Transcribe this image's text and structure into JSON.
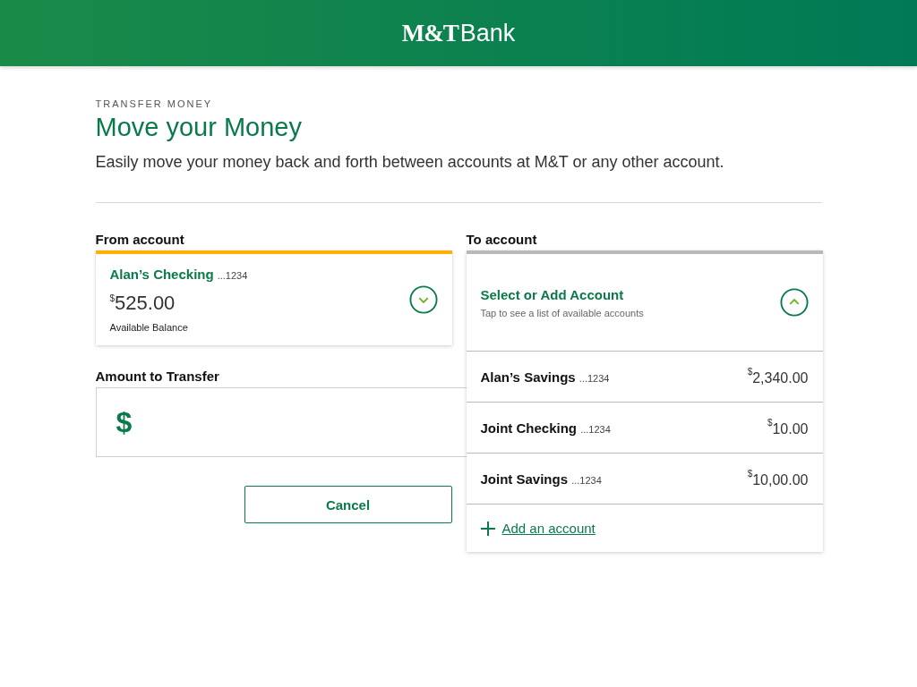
{
  "header": {
    "logo_bold": "M&T",
    "logo_light": "Bank"
  },
  "page": {
    "eyebrow": "TRANSFER MONEY",
    "title": "Move your Money",
    "description": "Easily move your money back and forth between accounts at M&T or any other account."
  },
  "from_account": {
    "label": "From account",
    "expanded": false,
    "name": "Alan’s Checking",
    "number": "...1234",
    "currency": "$",
    "balance": "525.00",
    "balance_label": "Available Balance"
  },
  "to_account": {
    "label": "To account",
    "expanded": true,
    "title": "Select or Add Account",
    "hint": "Tap to see a list of available accounts",
    "options": [
      {
        "name": "Alan’s Savings",
        "number": "...1234",
        "currency": "$",
        "amount": "2,340.00"
      },
      {
        "name": "Joint Checking",
        "number": "...1234",
        "currency": "$",
        "amount": "10.00"
      },
      {
        "name": "Joint Savings",
        "number": "...1234",
        "currency": "$",
        "amount": "10,00.00"
      }
    ],
    "add_link": "Add an account"
  },
  "amount": {
    "label": "Amount to Transfer",
    "prefix": "$"
  },
  "buttons": {
    "cancel": "Cancel"
  }
}
